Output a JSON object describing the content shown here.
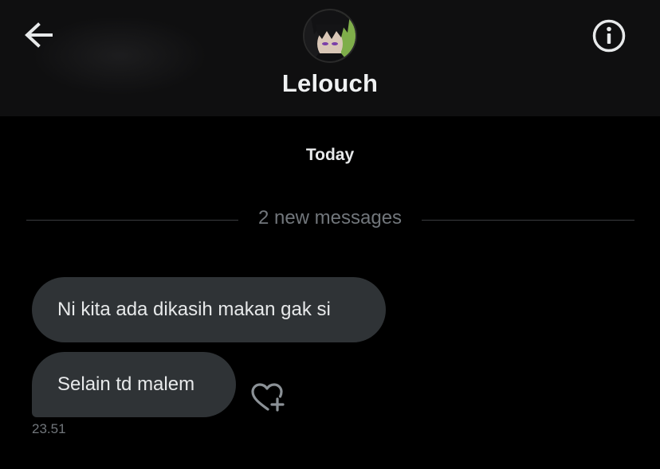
{
  "header": {
    "contact_name": "Lelouch",
    "back_icon": "arrow-left-icon",
    "info_icon": "info-circle-icon",
    "avatar_icon": "profile-avatar"
  },
  "conversation": {
    "date_label": "Today",
    "new_messages_label": "2 new messages",
    "messages": [
      {
        "text": "Ni kita ada dikasih makan gak si"
      },
      {
        "text": "Selain td malem"
      }
    ],
    "last_timestamp": "23.51",
    "react_icon": "heart-plus-icon"
  },
  "colors": {
    "background": "#000000",
    "header_background": "#0f0f10",
    "bubble": "#2f3336",
    "text_primary": "#e7e9ea",
    "text_secondary": "#71767b"
  }
}
